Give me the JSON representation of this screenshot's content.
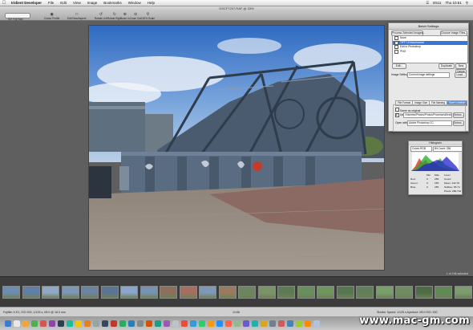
{
  "menubar": {
    "app_name": "Iridient Developer",
    "items": [
      "File",
      "Edit",
      "View",
      "Image",
      "Bookmarks",
      "Window",
      "Help"
    ],
    "status_right": [
      "E511",
      "Thu 10:51"
    ]
  },
  "window": {
    "title": "DSCF7207.RAF @ 33%"
  },
  "toolbar": {
    "items": [
      "ICE Fuji Raw",
      "Colour Profile",
      "Edit Raw/Aspect",
      "Rotate Left",
      "Rotate Right",
      "Zoom In",
      "Zoom Out",
      "100% Scale"
    ]
  },
  "batch": {
    "title": "Batch Settings",
    "process_button": "Process Selected Images...",
    "choose_button": "Choose Image Files...",
    "formats": [
      {
        "label": "None",
        "checked": false
      },
      {
        "label": "TIFF 16 bits/channel",
        "checked": true
      },
      {
        "label": "Edit in Photoshop",
        "checked": false
      },
      {
        "label": "PNG",
        "checked": false
      }
    ],
    "edit_button": "Edit...",
    "duplicate_button": "Duplicate",
    "new_button": "New",
    "delete_button": "Delete",
    "image_settings_label": "Image Settings:",
    "image_settings_value": "Current image settings",
    "load_button": "Load...",
    "tabs": [
      "File Format",
      "Image Size",
      "File Naming",
      "Save Location"
    ],
    "active_tab": "Save Location",
    "same_as_original": "Same as original",
    "use_label": "Use",
    "path_value": "/Volumes/Photos/Photos/Processed/ArchiveIrid...",
    "select_button": "Select...",
    "open_with_label": "Open with:",
    "open_with_value": "Adobe Photoshop CC",
    "select_button_2": "Select..."
  },
  "histogram": {
    "title": "Histogram",
    "colorspace": "Colors RGB",
    "bit_depth": "Bit Count: 256",
    "headers": [
      "Min",
      "Max",
      "Level"
    ],
    "rows": [
      {
        "label": "Red:",
        "min": "0",
        "max": "255"
      },
      {
        "label": "Green:",
        "min": "0",
        "max": "255"
      },
      {
        "label": "Blue:",
        "min": "0",
        "max": "255"
      }
    ],
    "extra": [
      "Count:",
      "Mean: 132.78",
      "StdDev: 65.74",
      "Pixels: 288,704"
    ]
  },
  "status": {
    "selection_count": "1 of 196 selected",
    "left_text": "Fujifilm X-E1, ISO 200, 1/125 s, f/8.0 @ 18.0 mm",
    "center_text": "1/196",
    "right_text": "Shutter Speed: 1/125 s    Aperture: f/8.0    ISO: 200"
  },
  "filmstrip": {
    "thumbnails": [
      "#6d8db0",
      "#5f7fa8",
      "#8fa8c4",
      "#7c97b8",
      "#6a84a3",
      "#5a7694",
      "#8aa6cc",
      "#7793b4",
      "#8e6f5a",
      "#a66e5e",
      "#7e98b9",
      "#9a7b5e",
      "#6c8560",
      "#7b9466",
      "#5c7b55",
      "#68905c",
      "#70955f",
      "#56774e",
      "#617f58",
      "#7aa06a",
      "#6e8e62",
      "#4d6b45",
      "#5f8a56",
      "#7c9c70"
    ]
  },
  "watermark": "www.mac-gm.com"
}
